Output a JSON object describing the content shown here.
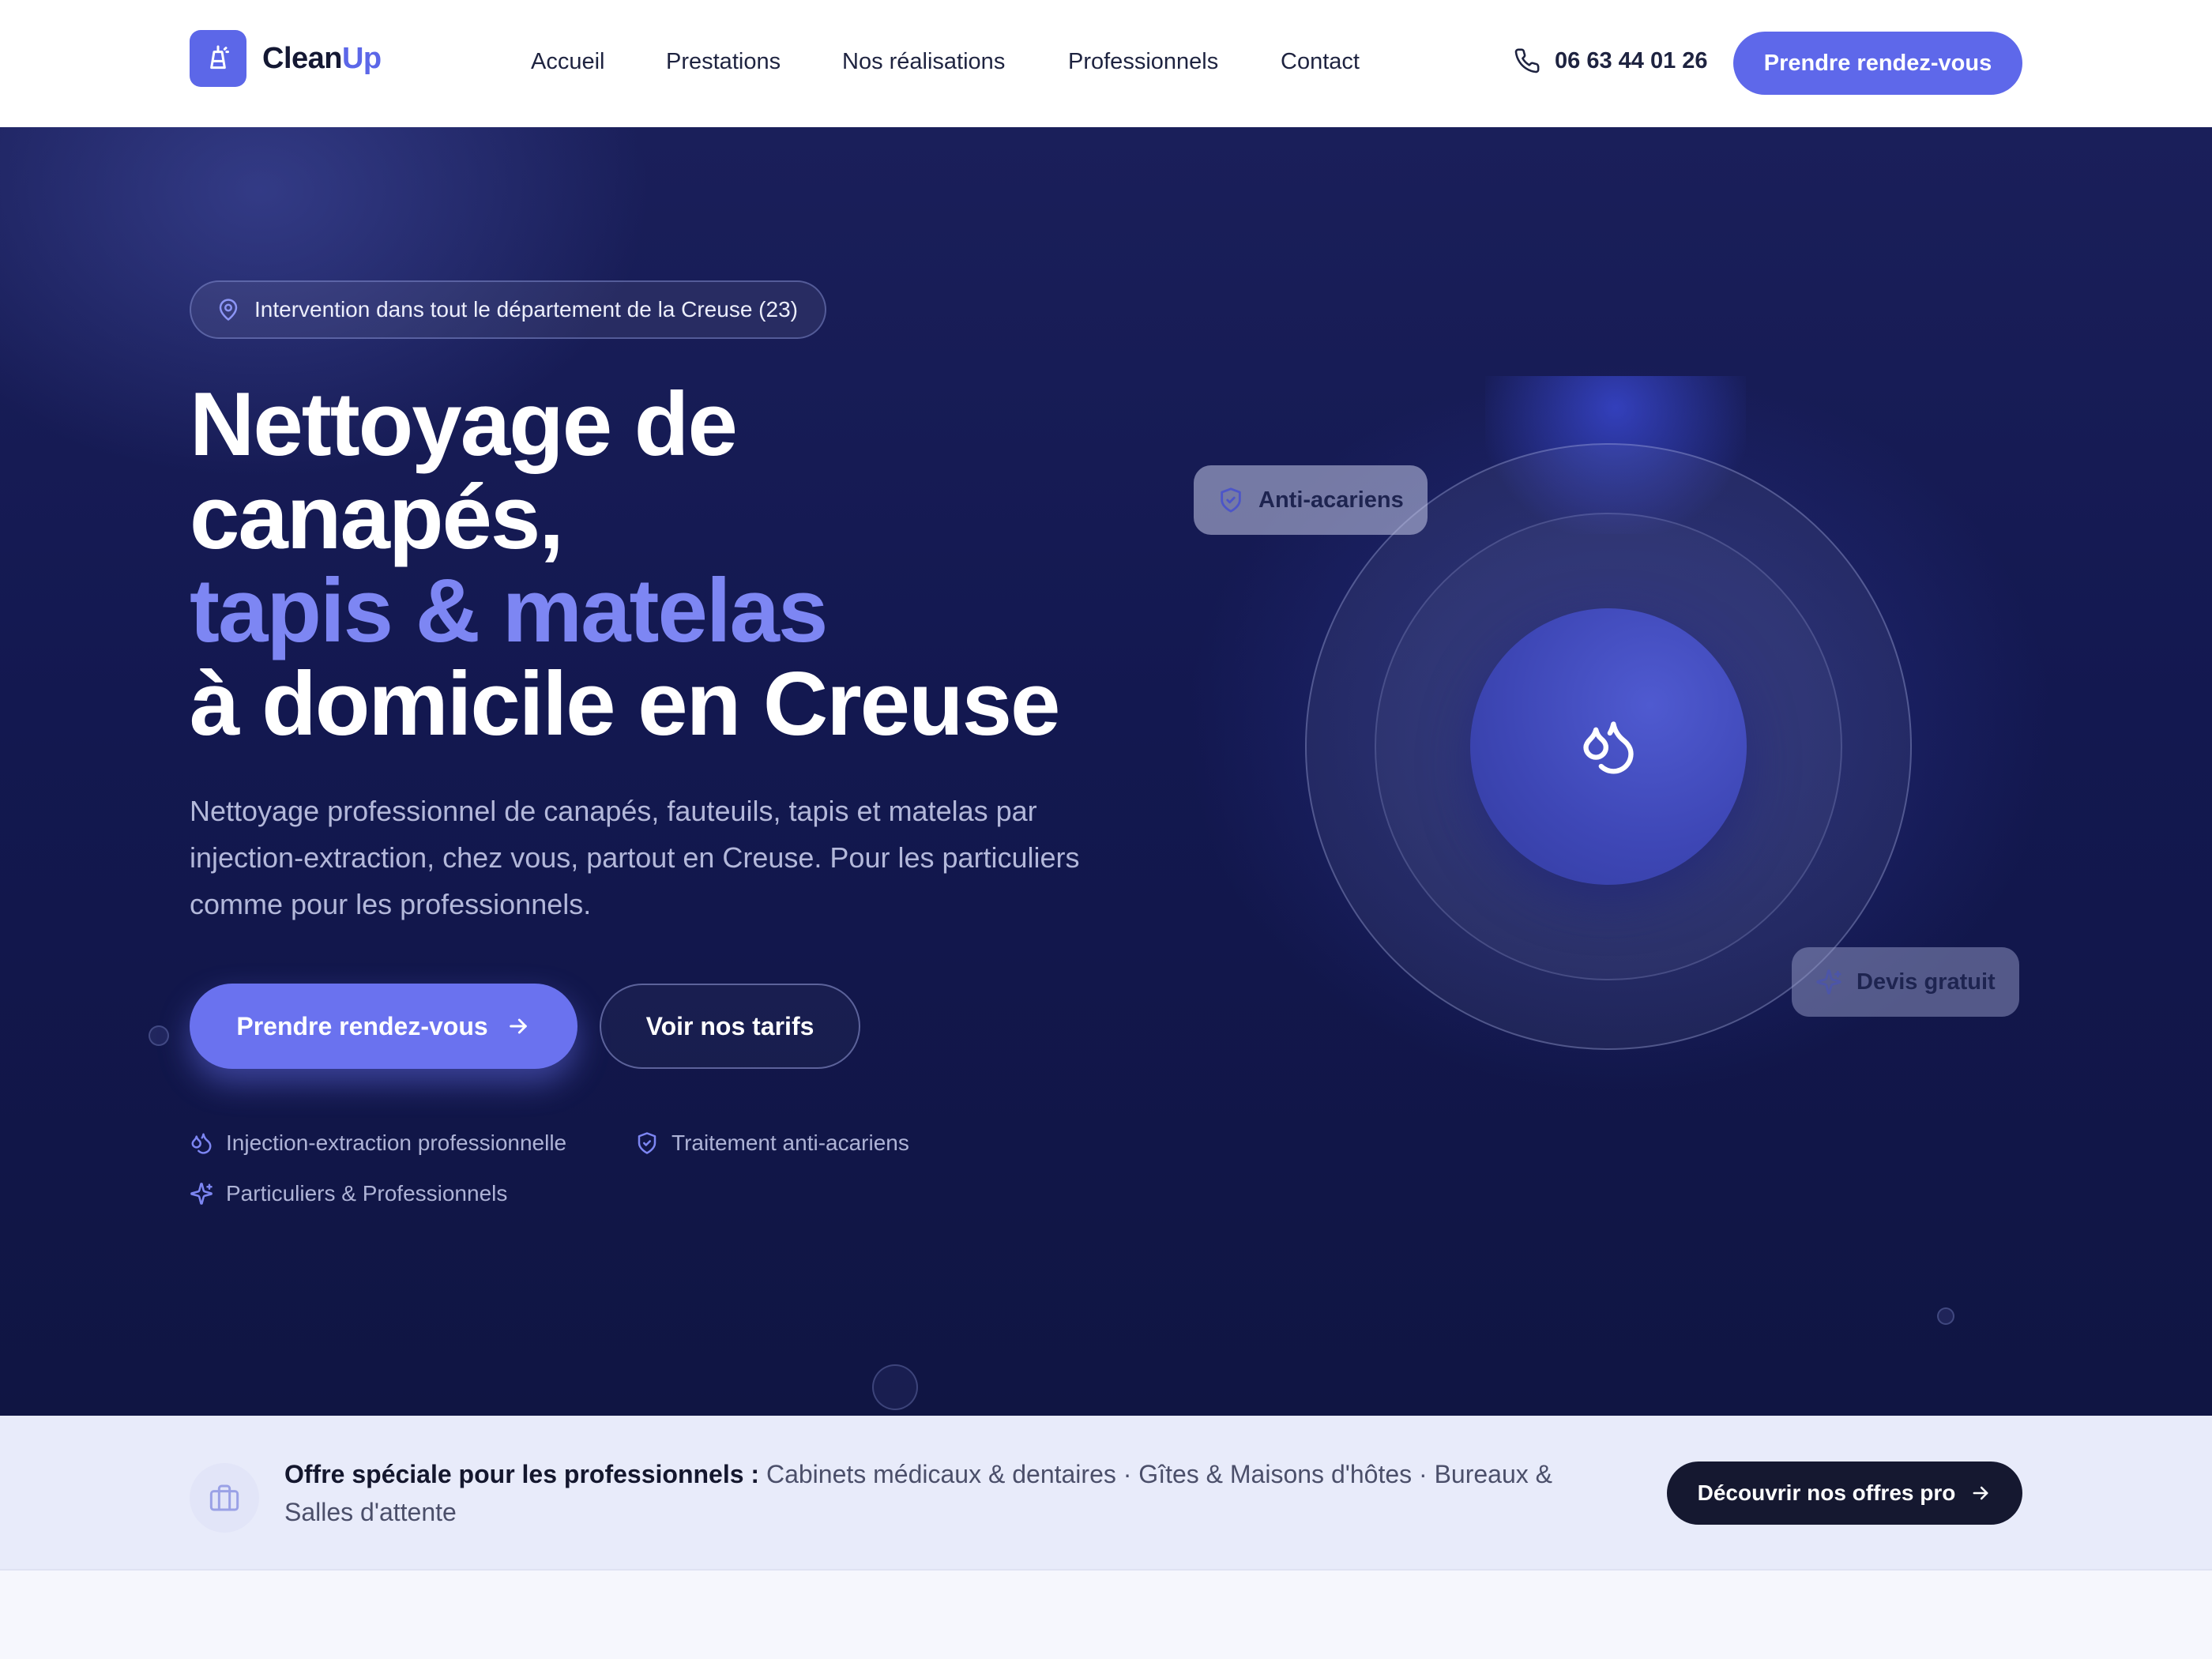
{
  "header": {
    "logo": {
      "text_main": "Clean",
      "text_accent": "Up"
    },
    "nav": [
      {
        "label": "Accueil"
      },
      {
        "label": "Prestations"
      },
      {
        "label": "Nos réalisations"
      },
      {
        "label": "Professionnels"
      },
      {
        "label": "Contact"
      }
    ],
    "phone": "06 63 44 01 26",
    "cta_label": "Prendre rendez-vous"
  },
  "hero": {
    "location_pill": "Intervention dans tout le département de la Creuse (23)",
    "title_line1": "Nettoyage de",
    "title_line2": "canapés,",
    "title_highlight": "tapis & matelas",
    "title_line4": "à domicile en Creuse",
    "description": "Nettoyage professionnel de canapés, fauteuils, tapis et matelas par injection-extraction, chez vous, partout en Creuse. Pour les particuliers comme pour les professionnels.",
    "primary_cta": "Prendre rendez-vous",
    "secondary_cta": "Voir nos tarifs",
    "features": [
      {
        "label": "Injection-extraction professionnelle",
        "icon": "droplets-icon"
      },
      {
        "label": "Traitement anti-acariens",
        "icon": "shield-icon"
      },
      {
        "label": "Particuliers & Professionnels",
        "icon": "sparkles-icon"
      }
    ],
    "badges": {
      "anti_mites": "Anti-acariens",
      "free_quote": "Devis gratuit"
    }
  },
  "pro_banner": {
    "title": "Offre spéciale pour les professionnels :",
    "text": "Cabinets médicaux & dentaires · Gîtes & Maisons d'hôtes · Bureaux & Salles d'attente",
    "cta_label": "Découvrir nos offres pro"
  },
  "colors": {
    "accent": "#5c67e8",
    "highlight": "#7d86f3",
    "hero_bg": "#131850",
    "dark_button": "#151830"
  }
}
